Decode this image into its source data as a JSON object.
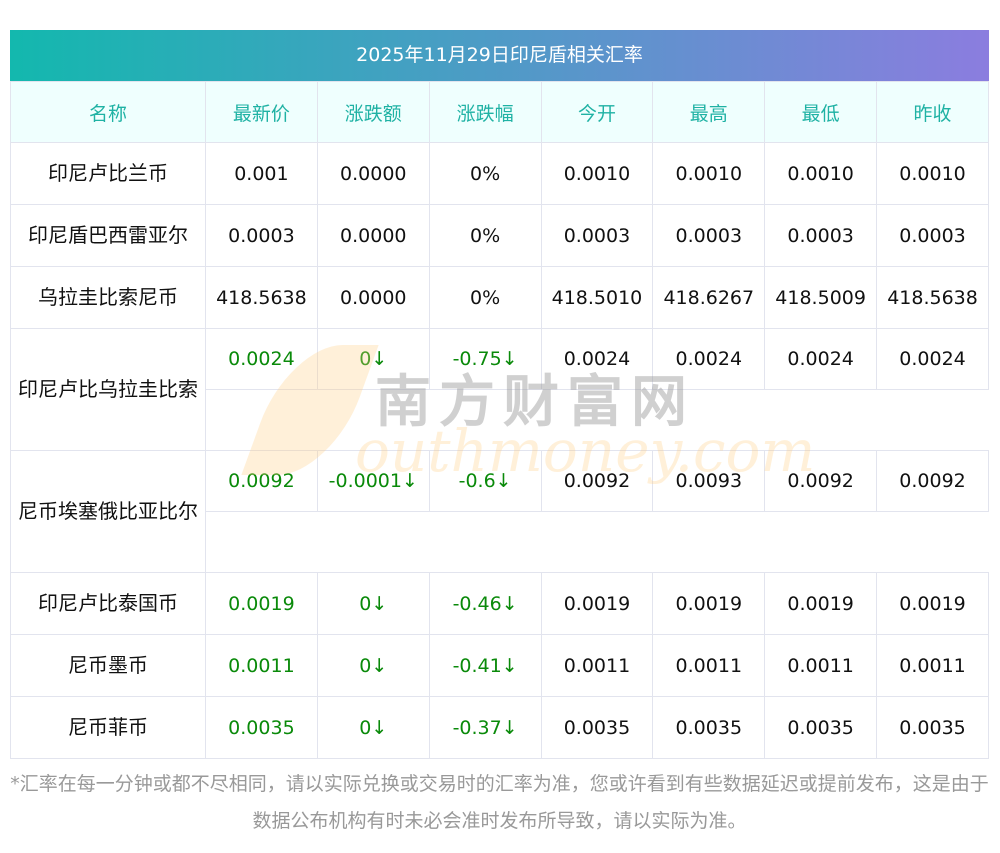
{
  "title": "2025年11月29日印尼盾相关汇率",
  "headers": [
    "名称",
    "最新价",
    "涨跌额",
    "涨跌幅",
    "今开",
    "最高",
    "最低",
    "昨收"
  ],
  "rows": [
    {
      "name": "印尼卢比兰币",
      "cells": [
        "0.001",
        "0.0000",
        "0%",
        "0.0010",
        "0.0010",
        "0.0010",
        "0.0010"
      ],
      "change": false,
      "wrap": false
    },
    {
      "name": "印尼盾巴西雷亚尔",
      "cells": [
        "0.0003",
        "0.0000",
        "0%",
        "0.0003",
        "0.0003",
        "0.0003",
        "0.0003"
      ],
      "change": false,
      "wrap": false
    },
    {
      "name": "乌拉圭比索尼币",
      "cells": [
        "418.5638",
        "0.0000",
        "0%",
        "418.5010",
        "418.6267",
        "418.5009",
        "418.5638"
      ],
      "change": false,
      "wrap": false
    },
    {
      "name": "印尼卢比乌拉圭比索",
      "cells": [
        "0.0024",
        "0↓",
        "-0.75↓",
        "0.0024",
        "0.0024",
        "0.0024",
        "0.0024"
      ],
      "change": true,
      "wrap": true
    },
    {
      "name": "尼币埃塞俄比亚比尔",
      "cells": [
        "0.0092",
        "-0.0001↓",
        "-0.6↓",
        "0.0092",
        "0.0093",
        "0.0092",
        "0.0092"
      ],
      "change": true,
      "wrap": true
    },
    {
      "name": "印尼卢比泰国币",
      "cells": [
        "0.0019",
        "0↓",
        "-0.46↓",
        "0.0019",
        "0.0019",
        "0.0019",
        "0.0019"
      ],
      "change": true,
      "wrap": false
    },
    {
      "name": "尼币墨币",
      "cells": [
        "0.0011",
        "0↓",
        "-0.41↓",
        "0.0011",
        "0.0011",
        "0.0011",
        "0.0011"
      ],
      "change": true,
      "wrap": false
    },
    {
      "name": "尼币菲币",
      "cells": [
        "0.0035",
        "0↓",
        "-0.37↓",
        "0.0035",
        "0.0035",
        "0.0035",
        "0.0035"
      ],
      "change": true,
      "wrap": false
    }
  ],
  "colors": {
    "down": "#0a8a0a",
    "header_text": "#1fb2a4"
  },
  "watermark": {
    "cn": "南方财富网",
    "en": "outhmoney.com"
  },
  "note": "*汇率在每一分钟或都不尽相同，请以实际兑换或交易时的汇率为准，您或许看到有些数据延迟或提前发布，这是由于数据公布机构有时未必会准时发布所导致，请以实际为准。"
}
